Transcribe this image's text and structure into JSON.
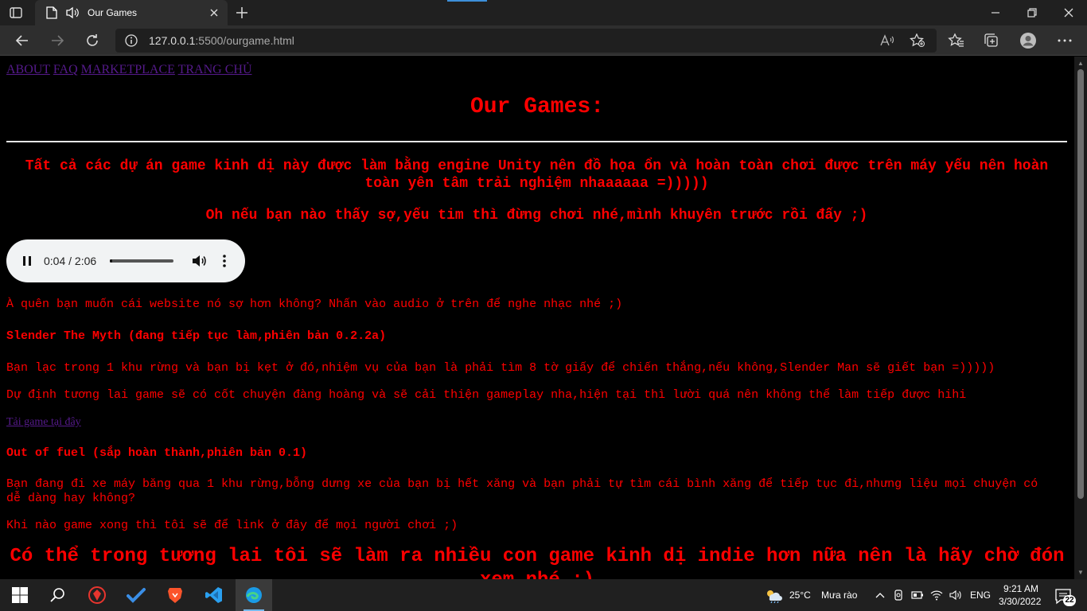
{
  "browser": {
    "tab_title": "Our Games",
    "url_host": "127.0.0.1",
    "url_rest": ":5500/ourgame.html"
  },
  "nav_links": [
    "ABOUT",
    "FAQ",
    "MARKETPLACE",
    "TRANG CHỦ"
  ],
  "page": {
    "heading": "Our Games:",
    "intro1": "Tất cả các dự án game kinh dị này được làm bằng engine Unity nên đồ họa ổn và hoàn toàn chơi được trên máy yếu nên hoàn toàn yên tâm trải nghiệm nhaaaaaa =)))))",
    "intro2": "Oh nếu bạn nào thấy sợ,yếu tim thì đừng chơi nhé,mình khuyên trước rồi đấy ;)",
    "audio": {
      "time": "0:04 / 2:06",
      "progress": 0.032
    },
    "audio_note": "À quên bạn muốn cái website nó sợ hơn không? Nhấn vào audio ở trên để nghe nhạc nhé ;)",
    "game1_title": "Slender The Myth (đang tiếp tục làm,phiên bản 0.2.2a)",
    "game1_desc": "Bạn lạc trong 1 khu rừng và bạn bị kẹt ở đó,nhiệm vụ của bạn là phải tìm 8 tờ giấy để chiến thắng,nếu không,Slender Man sẽ giết bạn =)))))",
    "game1_future": "Dự định tương lai game sẽ có cốt chuyện đàng hoàng và sẽ cải thiện gameplay nha,hiện tại thì lười quá nên không thể làm tiếp được hihi",
    "game1_download": "Tải game tại đây",
    "game2_title": "Out of fuel (sắp hoàn thành,phiên bản 0.1)",
    "game2_desc": "Bạn đang đi xe máy băng qua 1 khu rừng,bỗng dưng xe của bạn bị hết xăng và bạn phải tự tìm cái bình xăng để tiếp tục đi,nhưng liệu mọi chuyện có dễ dàng hay không?",
    "game2_note": "Khi nào game xong thì tôi sẽ để link ở đây để mọi người chơi ;)",
    "closing": "Có thể trong tương lai tôi sẽ làm ra nhiều con game kinh dị indie hơn nữa nên là hãy chờ đón xem nhé ;)"
  },
  "taskbar": {
    "temperature": "25°C",
    "condition": "Mưa rào",
    "language": "ENG",
    "time": "9:21 AM",
    "date": "3/30/2022",
    "notifications": "22"
  },
  "colors": {
    "text_red": "#ff0000",
    "link_visited": "#551a8b",
    "chrome_dark": "#202020"
  }
}
